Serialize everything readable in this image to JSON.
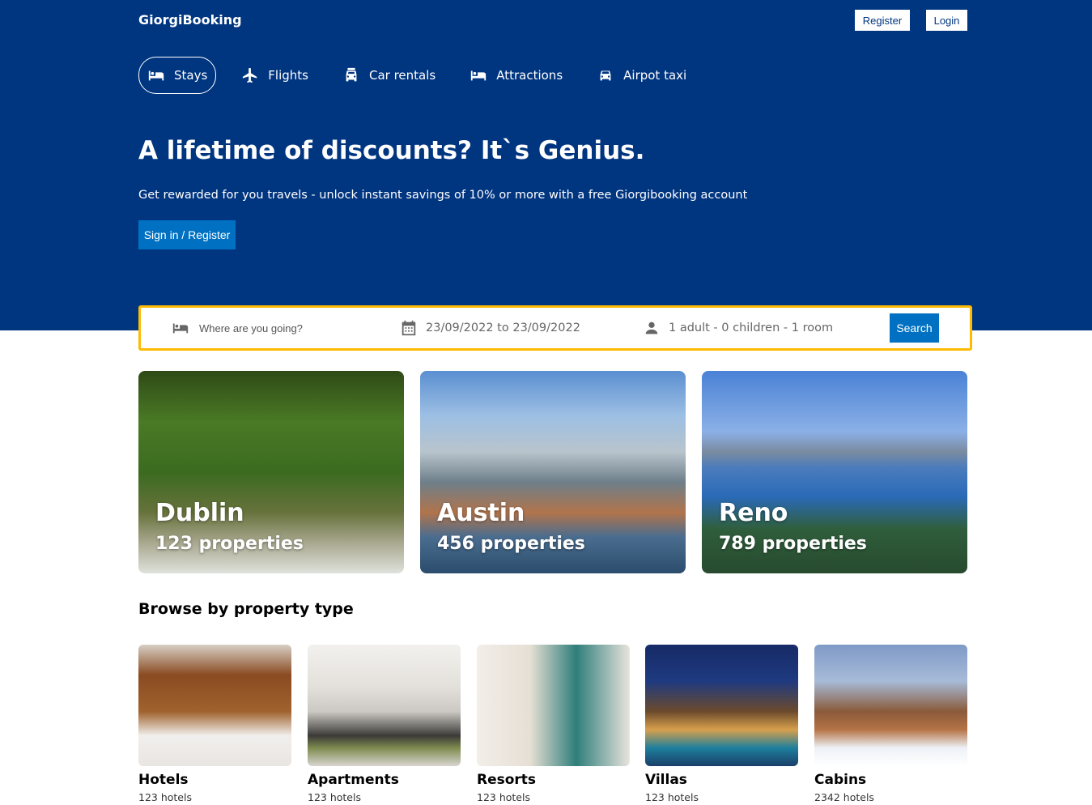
{
  "header": {
    "logo": "GiorgiBooking",
    "register_label": "Register",
    "login_label": "Login"
  },
  "nav": [
    {
      "label": "Stays",
      "icon": "bed-icon",
      "active": true
    },
    {
      "label": "Flights",
      "icon": "plane-icon",
      "active": false
    },
    {
      "label": "Car rentals",
      "icon": "car-rental-icon",
      "active": false
    },
    {
      "label": "Attractions",
      "icon": "bed-icon",
      "active": false
    },
    {
      "label": "Airpot taxi",
      "icon": "taxi-icon",
      "active": false
    }
  ],
  "hero": {
    "title": "A lifetime of discounts? It`s Genius.",
    "subtitle": "Get rewarded for you travels - unlock instant savings of 10% or more with a free Giorgibooking account",
    "cta_label": "Sign in / Register"
  },
  "search": {
    "destination_placeholder": "Where are you going?",
    "dates": "23/09/2022 to 23/09/2022",
    "guests": "1 adult - 0 children - 1 room",
    "button_label": "Search"
  },
  "featured": [
    {
      "city": "Dublin",
      "properties": "123 properties"
    },
    {
      "city": "Austin",
      "properties": "456 properties"
    },
    {
      "city": "Reno",
      "properties": "789 properties"
    }
  ],
  "property_section": {
    "title": "Browse by property type",
    "items": [
      {
        "name": "Hotels",
        "count": "123 hotels"
      },
      {
        "name": "Apartments",
        "count": "123 hotels"
      },
      {
        "name": "Resorts",
        "count": "123 hotels"
      },
      {
        "name": "Villas",
        "count": "123 hotels"
      },
      {
        "name": "Cabins",
        "count": "2342 hotels"
      }
    ]
  },
  "colors": {
    "header_bg": "#003580",
    "primary_button": "#0071c2",
    "search_border": "#febb02"
  }
}
